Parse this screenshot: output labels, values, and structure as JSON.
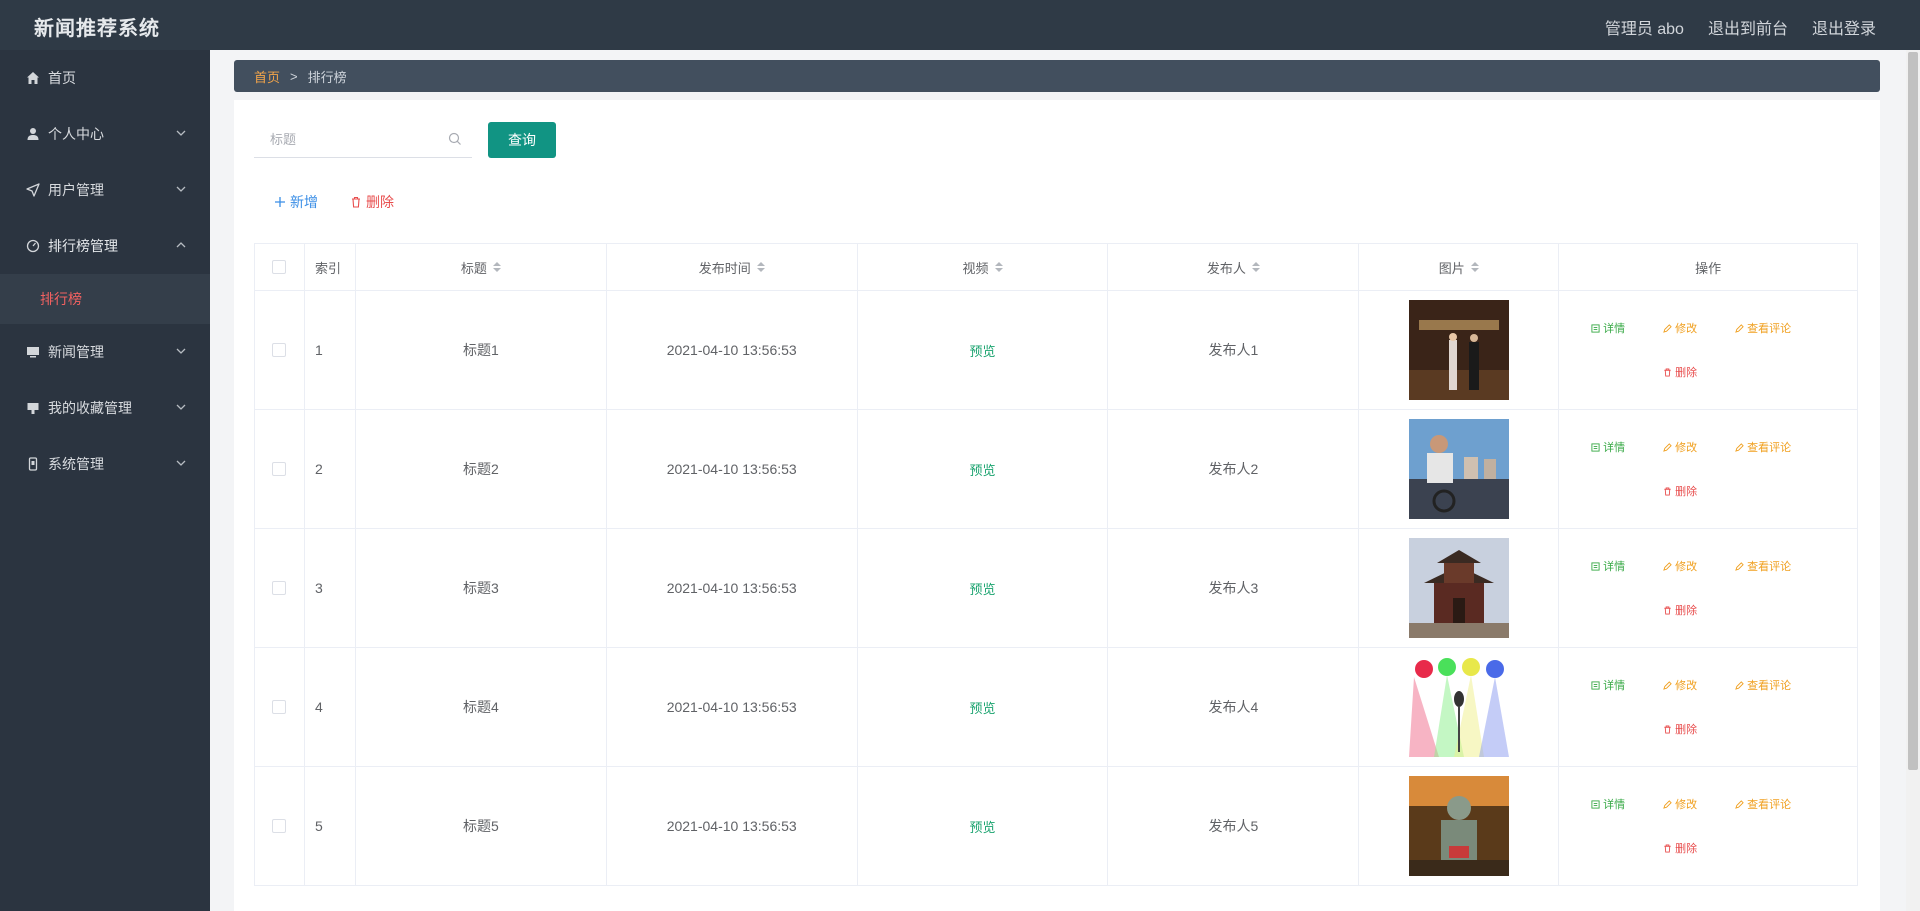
{
  "header": {
    "app_title": "新闻推荐系统",
    "admin_label": "管理员 abo",
    "to_front_label": "退出到前台",
    "logout_label": "退出登录"
  },
  "sidebar": {
    "items": [
      {
        "label": "首页",
        "icon": "home-icon"
      },
      {
        "label": "个人中心",
        "icon": "user-icon"
      },
      {
        "label": "用户管理",
        "icon": "send-icon"
      },
      {
        "label": "排行榜管理",
        "icon": "gauge-icon"
      },
      {
        "label": "新闻管理",
        "icon": "monitor-icon"
      },
      {
        "label": "我的收藏管理",
        "icon": "stamp-icon"
      },
      {
        "label": "系统管理",
        "icon": "phone-icon"
      }
    ],
    "sub_item": "排行榜"
  },
  "breadcrumb": {
    "home": "首页",
    "sep": ">",
    "current": "排行榜"
  },
  "search": {
    "placeholder": "标题",
    "button": "查询"
  },
  "actions": {
    "add": "新增",
    "delete": "删除"
  },
  "table": {
    "headers": {
      "index": "索引",
      "title": "标题",
      "time": "发布时间",
      "video": "视频",
      "publisher": "发布人",
      "image": "图片",
      "ops": "操作"
    },
    "ops_labels": {
      "detail": "详情",
      "edit": "修改",
      "comment": "查看评论",
      "delete": "删除"
    },
    "rows": [
      {
        "index": "1",
        "title": "标题1",
        "time": "2021-04-10 13:56:53",
        "video": "预览",
        "publisher": "发布人1",
        "image": "award-ceremony-photo"
      },
      {
        "index": "2",
        "title": "标题2",
        "time": "2021-04-10 13:56:53",
        "video": "预览",
        "publisher": "发布人2",
        "image": "gym-cycling-photo"
      },
      {
        "index": "3",
        "title": "标题3",
        "time": "2021-04-10 13:56:53",
        "video": "预览",
        "publisher": "发布人3",
        "image": "pagoda-photo"
      },
      {
        "index": "4",
        "title": "标题4",
        "time": "2021-04-10 13:56:53",
        "video": "预览",
        "publisher": "发布人4",
        "image": "stage-microphone-photo"
      },
      {
        "index": "5",
        "title": "标题5",
        "time": "2021-04-10 13:56:53",
        "video": "预览",
        "publisher": "发布人5",
        "image": "statue-photo"
      }
    ]
  },
  "colors": {
    "topbar": "#2f3a46",
    "sidebar": "#2b3440",
    "active_menu": "#f26161",
    "primary_button": "#119483",
    "breadcrumb_home": "#f3a54a"
  }
}
